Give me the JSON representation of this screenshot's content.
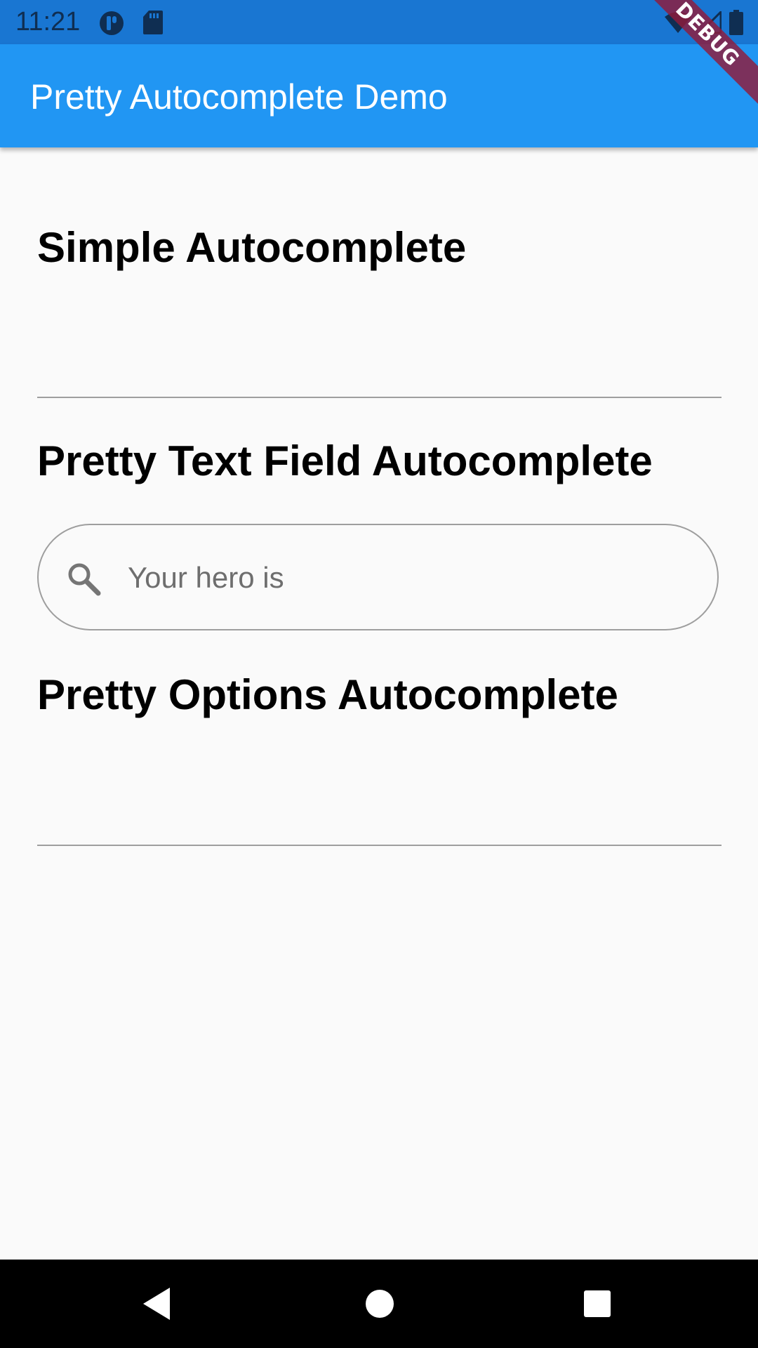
{
  "status_bar": {
    "time": "11:21",
    "color": "#1976d2",
    "icons": [
      "app-notification-icon",
      "sd-card-icon",
      "wifi-icon",
      "signal-icon",
      "battery-icon"
    ]
  },
  "app_bar": {
    "title": "Pretty Autocomplete Demo",
    "color": "#2196f3"
  },
  "debug_banner": {
    "label": "DEBUG"
  },
  "sections": {
    "simple": {
      "title": "Simple Autocomplete"
    },
    "text_field": {
      "title": "Pretty Text Field Autocomplete",
      "search": {
        "placeholder": "Your hero is",
        "value": "",
        "icon": "search-icon"
      }
    },
    "options": {
      "title": "Pretty Options Autocomplete"
    }
  },
  "nav_bar": {
    "buttons": [
      "back-icon",
      "home-icon",
      "recents-icon"
    ]
  }
}
